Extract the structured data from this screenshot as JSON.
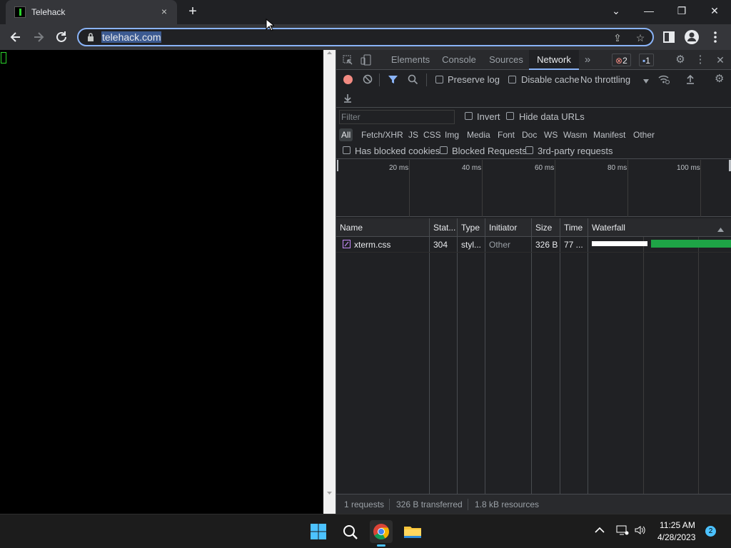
{
  "browser": {
    "tab_title": "Telehack",
    "tab_close_icon": "×",
    "new_tab_icon": "+",
    "url": "telehack.com",
    "window_controls": {
      "dropdown": "⌄",
      "minimize": "—",
      "restore": "❐",
      "close": "✕"
    }
  },
  "devtools": {
    "tabs": [
      {
        "label": "Elements"
      },
      {
        "label": "Console"
      },
      {
        "label": "Sources"
      },
      {
        "label": "Network"
      }
    ],
    "more_tabs_icon": "»",
    "errors_count": "2",
    "messages_count": "1",
    "toolbar": {
      "preserve_log": "Preserve log",
      "disable_cache": "Disable cache",
      "throttling": "No throttling"
    },
    "filter": {
      "placeholder": "Filter",
      "invert": "Invert",
      "hide_data_urls": "Hide data URLs",
      "types": [
        "All",
        "Fetch/XHR",
        "JS",
        "CSS",
        "Img",
        "Media",
        "Font",
        "Doc",
        "WS",
        "Wasm",
        "Manifest",
        "Other"
      ],
      "has_blocked_cookies": "Has blocked cookies",
      "blocked_requests": "Blocked Requests",
      "third_party": "3rd-party requests"
    },
    "overview_ticks": [
      "20 ms",
      "40 ms",
      "60 ms",
      "80 ms",
      "100 ms"
    ],
    "columns": {
      "name": "Name",
      "status": "Stat...",
      "type": "Type",
      "initiator": "Initiator",
      "size": "Size",
      "time": "Time",
      "waterfall": "Waterfall"
    },
    "rows": [
      {
        "name": "xterm.css",
        "status": "304",
        "type": "styl...",
        "initiator": "Other",
        "size": "326 B",
        "time": "77 ..."
      }
    ],
    "status": {
      "requests": "1 requests",
      "transferred": "326 B transferred",
      "resources": "1.8 kB resources"
    }
  },
  "taskbar": {
    "time": "11:25 AM",
    "date": "4/28/2023",
    "notification_count": "2"
  },
  "colors": {
    "accent": "#8ab4f8",
    "terminal_green": "#2bd42b",
    "waterfall_green": "#1ea446",
    "record_red": "#f28b82"
  }
}
